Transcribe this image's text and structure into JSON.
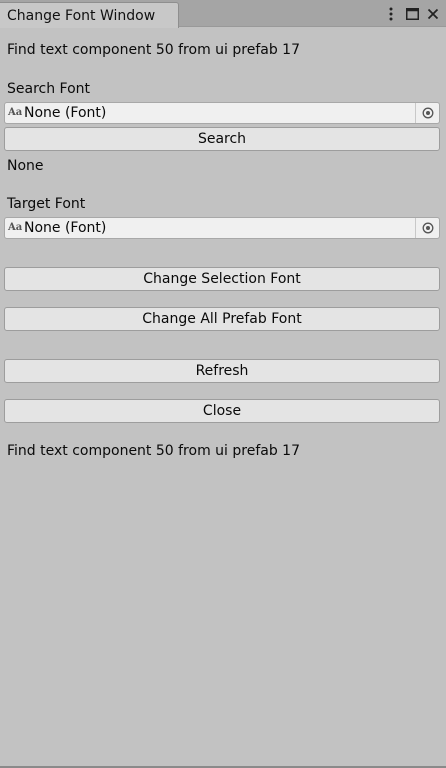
{
  "window": {
    "tab_title": "Change Font Window",
    "controls": [
      "more-options-icon",
      "maximize-icon",
      "close-icon"
    ]
  },
  "status_top": "Find text component 50 from ui prefab 17",
  "search_font": {
    "label": "Search Font",
    "value": "None (Font)",
    "icon": "font-asset-icon",
    "icon_text": "Aa"
  },
  "search_button": "Search",
  "search_result": "None",
  "target_font": {
    "label": "Target Font",
    "value": "None (Font)",
    "icon": "font-asset-icon",
    "icon_text": "Aa"
  },
  "buttons": {
    "change_selection": "Change Selection Font",
    "change_all": "Change All Prefab Font",
    "refresh": "Refresh",
    "close": "Close"
  },
  "status_bottom": "Find text component 50 from ui prefab 17"
}
